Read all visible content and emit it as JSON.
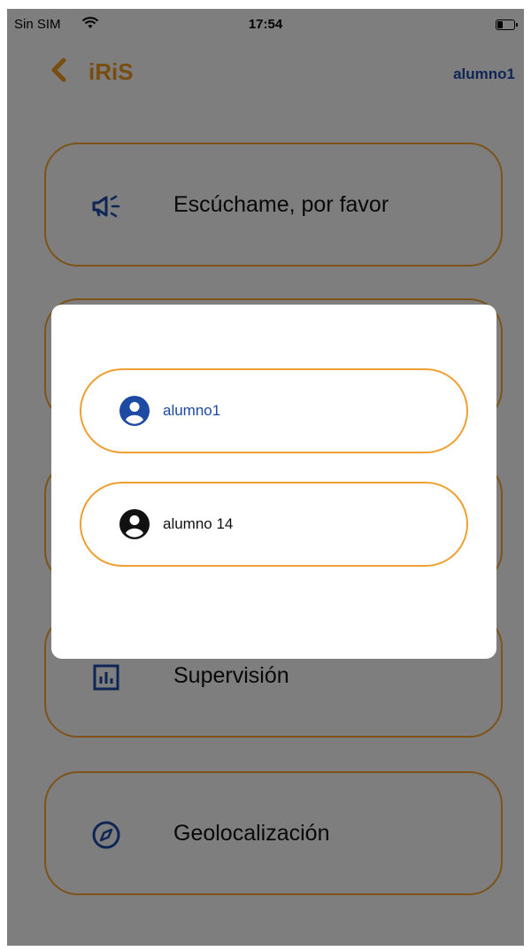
{
  "status_bar": {
    "carrier": "Sin SIM",
    "time": "17:54"
  },
  "nav": {
    "title": "iRiS",
    "user": "alumno1"
  },
  "menu": {
    "items": [
      {
        "label": "Escúchame, por favor",
        "icon": "megaphone-icon"
      },
      {
        "label": "",
        "icon": ""
      },
      {
        "label": "",
        "icon": ""
      },
      {
        "label": "Supervisión",
        "icon": "chart-icon"
      },
      {
        "label": "Geolocalización",
        "icon": "compass-icon"
      }
    ]
  },
  "modal": {
    "options": [
      {
        "label": "alumno1",
        "icon": "user-circle-icon",
        "color": "#1e4aa3"
      },
      {
        "label": "alumno 14",
        "icon": "user-circle-icon",
        "color": "#111111"
      }
    ]
  },
  "colors": {
    "accent": "#e8931f",
    "brand_blue": "#1e4aa3",
    "card_border": "#f0a030"
  }
}
